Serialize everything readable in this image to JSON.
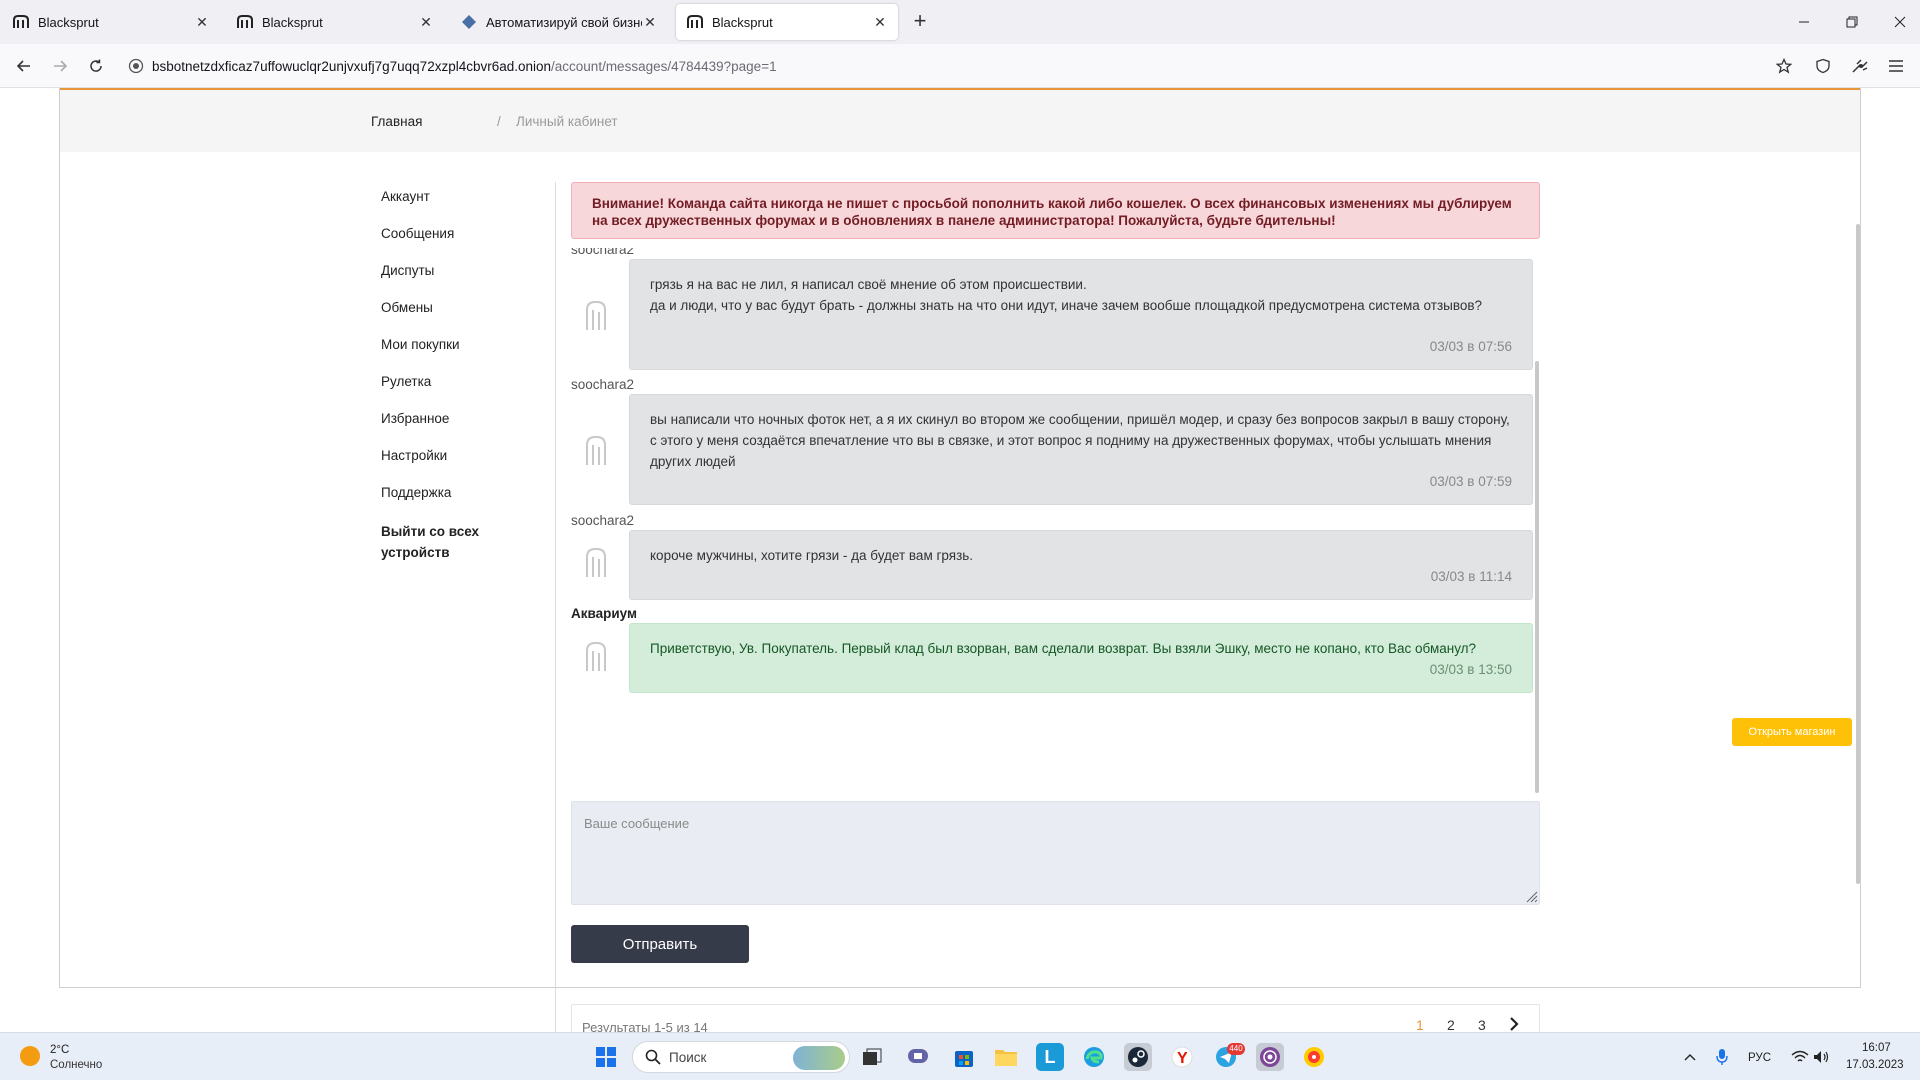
{
  "browser": {
    "tabs": [
      {
        "title": "Blacksprut",
        "active": false
      },
      {
        "title": "Blacksprut",
        "active": false
      },
      {
        "title": "Автоматизируй свой бизнес с",
        "active": false
      },
      {
        "title": "Blacksprut",
        "active": true
      }
    ],
    "url_host": "bsbotnetzdxficaz7uffowuclqr2unjvxufj7g7uqq72xzpl4cbvr6ad.onion",
    "url_path": "/account/messages/4784439?page=1"
  },
  "breadcrumb": {
    "home": "Главная",
    "separator": "/",
    "current": "Личный кабинет"
  },
  "sidebar": {
    "items": [
      {
        "label": "Аккаунт"
      },
      {
        "label": "Сообщения"
      },
      {
        "label": "Диспуты"
      },
      {
        "label": "Обмены"
      },
      {
        "label": "Мои покупки"
      },
      {
        "label": "Рулетка"
      },
      {
        "label": "Избранное"
      },
      {
        "label": "Настройки"
      },
      {
        "label": "Поддержка"
      },
      {
        "label": "Выйти со всех устройств"
      }
    ]
  },
  "alert": {
    "text": "Внимание! Команда сайта никогда не пишет с просьбой пополнить какой либо кошелек. О всех финансовых изменениях мы дублируем на всех дружественных форумах и в обновлениях в панеле администратора! Пожалуйста, будьте бдительны!"
  },
  "messages": [
    {
      "author": "soochara2",
      "lines": [
        "грязь я на вас не лил, я написал своё мнение об этом происшествии.",
        "да и люди, что у вас будут брать - должны знать на что они идут, иначе зачем вообше площадкой предусмотрена система отзывов?"
      ],
      "time": "03/03 в 07:56"
    },
    {
      "author": "soochara2",
      "lines": [
        "вы написали что ночных фоток нет, а я их скинул во втором же сообщении, пришёл модер, и сразу без вопросов закрыл в вашу сторону, с этого у меня создаётся впечатление что вы в связке, и этот вопрос я подниму на дружественных форумах, чтобы услышать мнения других людей"
      ],
      "time": "03/03 в 07:59"
    },
    {
      "author": "soochara2",
      "lines": [
        "короче мужчины, хотите грязи - да будет вам грязь."
      ],
      "time": "03/03 в 11:14"
    },
    {
      "author": "Аквариум",
      "lines": [
        "Приветствую, Ув. Покупатель. Первый клад был взорван, вам сделали возврат. Вы взяли Эшку, место не копано, кто Вас обманул?"
      ],
      "time": "03/03 в 13:50"
    }
  ],
  "compose": {
    "placeholder": "Ваше сообщение",
    "send_label": "Отправить"
  },
  "pagination": {
    "results_text": "Результаты 1-5 из 14",
    "pages": [
      "1",
      "2",
      "3"
    ],
    "current_page": "1"
  },
  "shop_button": "Открыть магазин",
  "taskbar": {
    "weather_temp": "2°C",
    "weather_desc": "Солнечно",
    "search_label": "Поиск",
    "telegram_badge": "440",
    "language": "РУС",
    "time": "16:07",
    "date": "17.03.2023"
  },
  "colors": {
    "accent_orange": "#e8963c",
    "alert_bg": "#f8d7da",
    "alert_text": "#721c24",
    "bubble_grey": "#e2e3e5",
    "bubble_green": "#d4edda",
    "send_button": "#353b48",
    "shop_button": "#ffc107"
  }
}
